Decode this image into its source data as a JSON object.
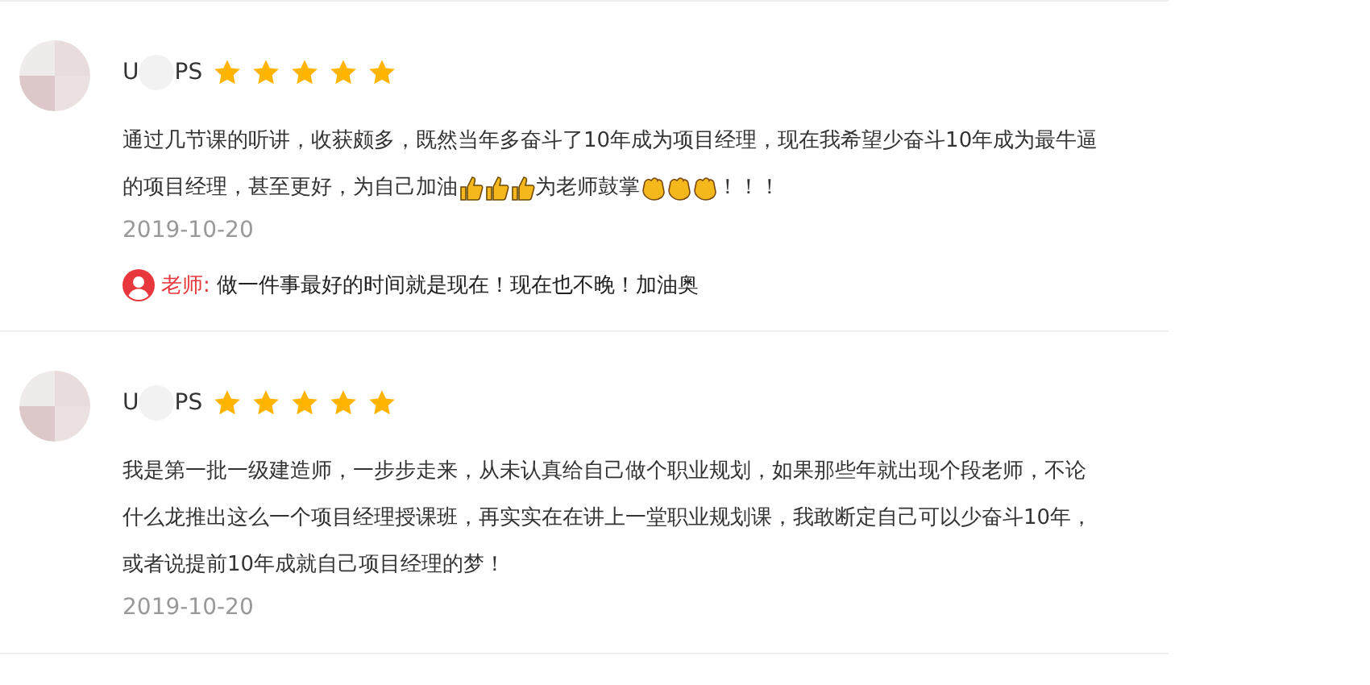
{
  "reviews": [
    {
      "name_start": "U",
      "name_end": "PS",
      "stars": 5,
      "body": [
        [
          {
            "kind": "text",
            "text": "通过几节课的听讲，收获颇多，既然当年多奋斗了10年成为项目经理，现在我希望少奋斗10年成为最牛逼"
          }
        ],
        [
          {
            "kind": "text",
            "text": "的项目经理，甚至更好，为自己加油"
          },
          {
            "kind": "thumbs"
          },
          {
            "kind": "thumbs"
          },
          {
            "kind": "thumbs"
          },
          {
            "kind": "text",
            "text": "为老师鼓掌"
          },
          {
            "kind": "clap"
          },
          {
            "kind": "clap"
          },
          {
            "kind": "clap"
          },
          {
            "kind": "text",
            "text": "！！！"
          }
        ]
      ],
      "date": "2019-10-20",
      "reply": {
        "author": "老师:",
        "text": "做一件事最好的时间就是现在！现在也不晚！加油奥"
      }
    },
    {
      "name_start": "U",
      "name_end": "PS",
      "stars": 5,
      "body": [
        [
          {
            "kind": "text",
            "text": "我是第一批一级建造师，一步步走来，从未认真给自己做个职业规划，如果那些年就出现个段老师，不论"
          }
        ],
        [
          {
            "kind": "text",
            "text": "什么龙推出这么一个项目经理授课班，再实实在在讲上一堂职业规划课，我敢断定自己可以少奋斗10年，"
          }
        ],
        [
          {
            "kind": "text",
            "text": "或者说提前10年成就自己项目经理的梦！"
          }
        ]
      ],
      "date": "2019-10-20"
    }
  ]
}
